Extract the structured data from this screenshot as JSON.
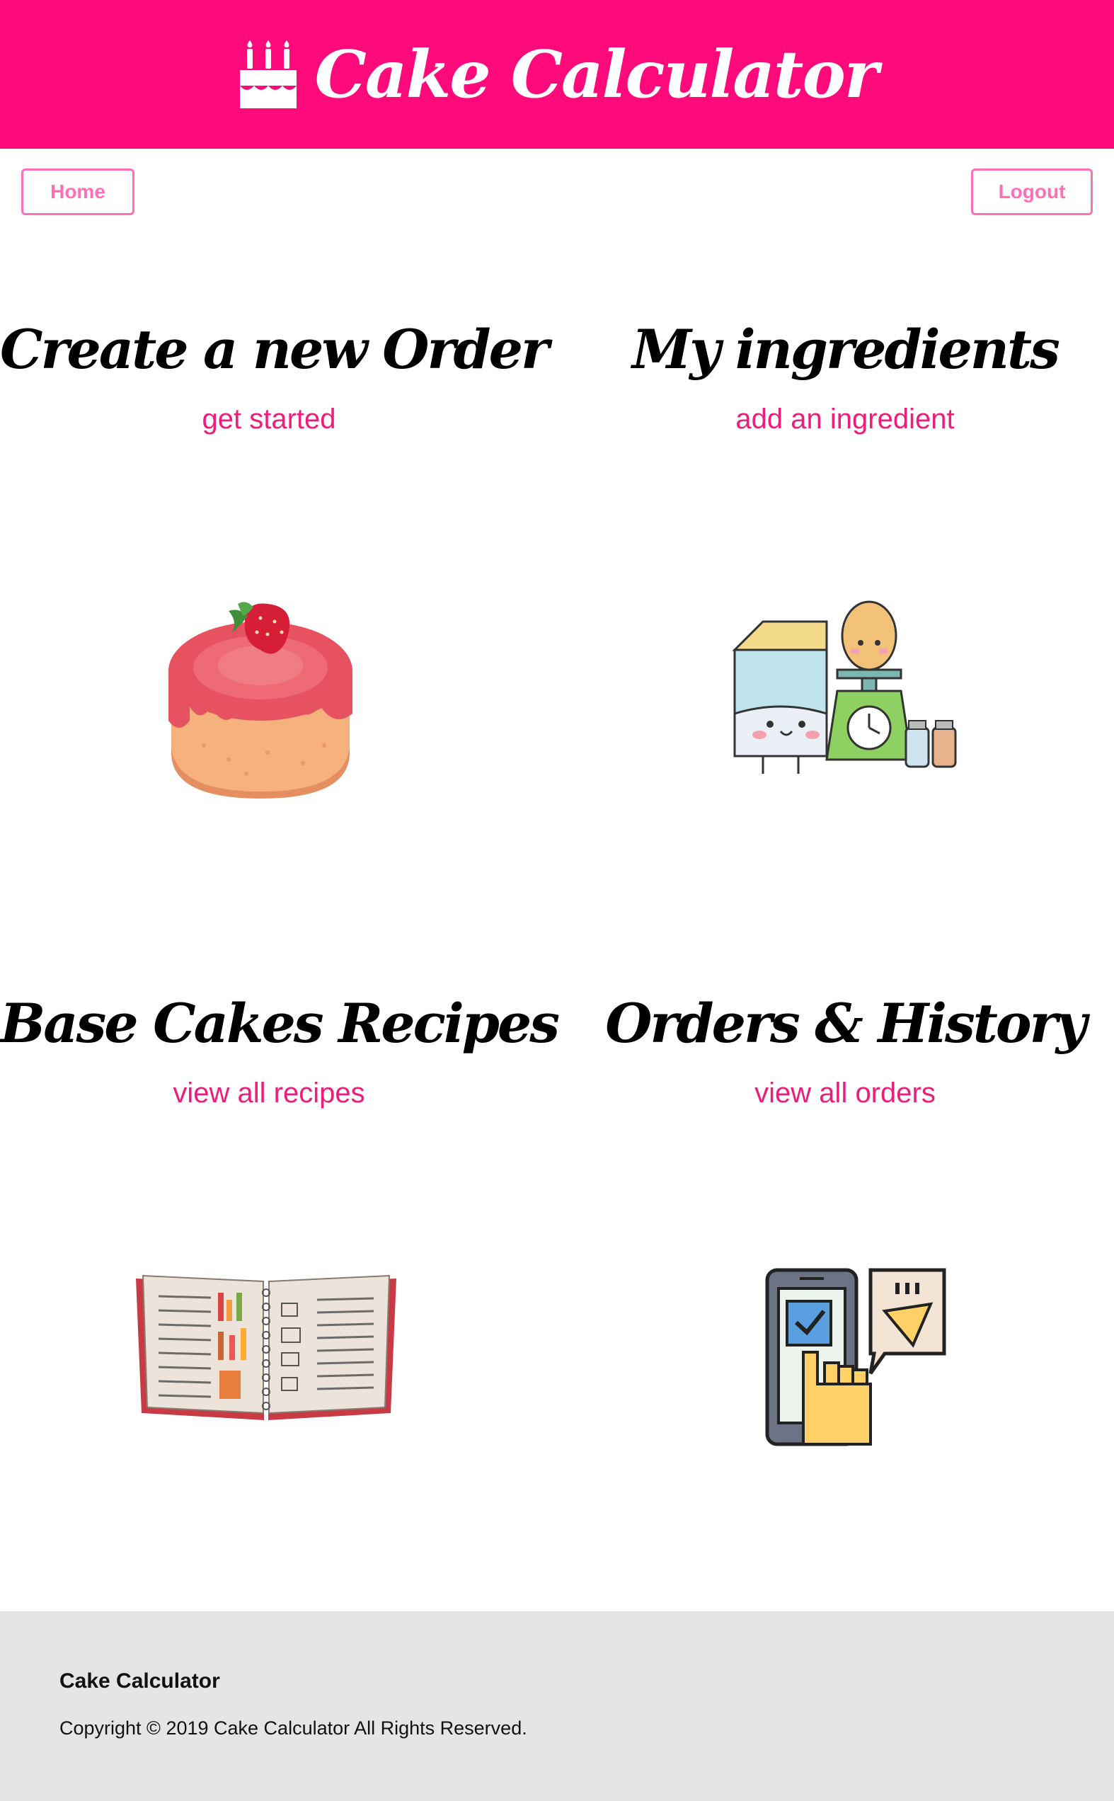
{
  "header": {
    "title": "Cake Calculator",
    "brand_icon": "birthday-cake-icon",
    "background": "#ff0a7a"
  },
  "nav": {
    "home_label": "Home",
    "logout_label": "Logout",
    "accent": "#ff6fb6"
  },
  "cards": [
    {
      "title": "Create a new Order",
      "link": "get started",
      "art": "strawberry-cake-illustration"
    },
    {
      "title": "My ingredients",
      "link": "add an ingredient",
      "art": "ingredients-illustration"
    },
    {
      "title": "Base Cakes Recipes",
      "link": "view all recipes",
      "art": "recipe-book-illustration"
    },
    {
      "title": "Orders & History",
      "link": "view all orders",
      "art": "mobile-order-illustration"
    }
  ],
  "link_color": "#ee1c7a",
  "footer": {
    "title": "Cake Calculator",
    "copyright": "Copyright © 2019 Cake Calculator All Rights Reserved.",
    "background": "#e5e5e5"
  }
}
